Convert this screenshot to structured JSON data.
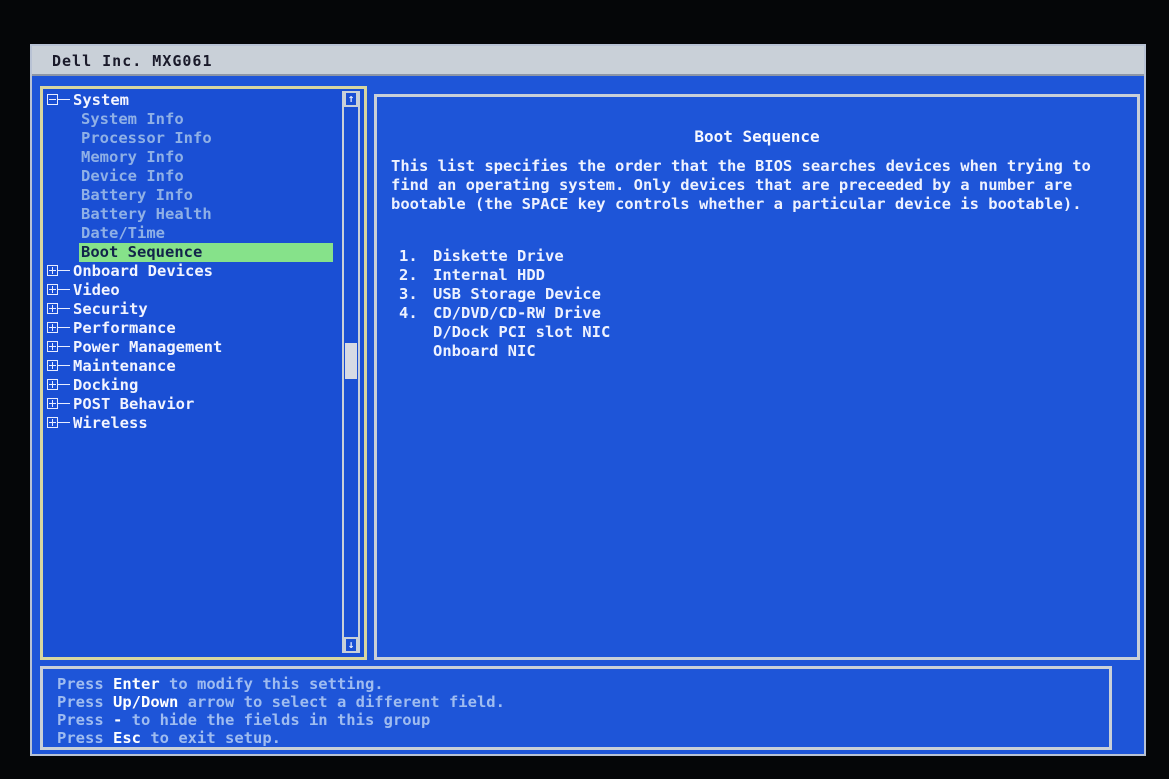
{
  "window": {
    "title": "Dell Inc. MXG061"
  },
  "tree": [
    {
      "label": "System",
      "expanded": true,
      "children": [
        {
          "label": "System Info"
        },
        {
          "label": "Processor Info"
        },
        {
          "label": "Memory Info"
        },
        {
          "label": "Device Info"
        },
        {
          "label": "Battery Info"
        },
        {
          "label": "Battery Health"
        },
        {
          "label": "Date/Time"
        },
        {
          "label": "Boot Sequence",
          "selected": true
        }
      ]
    },
    {
      "label": "Onboard Devices",
      "expanded": false
    },
    {
      "label": "Video",
      "expanded": false
    },
    {
      "label": "Security",
      "expanded": false
    },
    {
      "label": "Performance",
      "expanded": false
    },
    {
      "label": "Power Management",
      "expanded": false
    },
    {
      "label": "Maintenance",
      "expanded": false
    },
    {
      "label": "Docking",
      "expanded": false
    },
    {
      "label": "POST Behavior",
      "expanded": false
    },
    {
      "label": "Wireless",
      "expanded": false
    }
  ],
  "scrollbar": {
    "up_icon": "↑",
    "down_icon": "↓"
  },
  "detail": {
    "heading": "Boot Sequence",
    "description": "This list specifies the order that the BIOS searches devices when trying to find an operating system. Only devices that are preceeded by a number are bootable (the SPACE key controls whether a particular device is bootable).",
    "boot_devices": [
      {
        "number": "1.",
        "label": "Diskette Drive"
      },
      {
        "number": "2.",
        "label": "Internal HDD"
      },
      {
        "number": "3.",
        "label": "USB Storage Device"
      },
      {
        "number": "4.",
        "label": "CD/DVD/CD-RW Drive"
      },
      {
        "number": "",
        "label": "D/Dock PCI slot NIC"
      },
      {
        "number": "",
        "label": "Onboard NIC"
      }
    ]
  },
  "help": [
    {
      "prefix": "Press ",
      "key": "Enter",
      "suffix": " to modify this setting."
    },
    {
      "prefix": "Press ",
      "key": "Up/Down",
      "suffix": " arrow to select a different field."
    },
    {
      "prefix": "Press ",
      "key": "-",
      "suffix": " to hide the fields in this group"
    },
    {
      "prefix": "Press ",
      "key": "Esc",
      "suffix": " to exit setup."
    }
  ],
  "colors": {
    "background": "#1e55d8",
    "selection": "#86e28a",
    "disabled_text": "#8fb0e6",
    "text": "#eef2ff"
  }
}
